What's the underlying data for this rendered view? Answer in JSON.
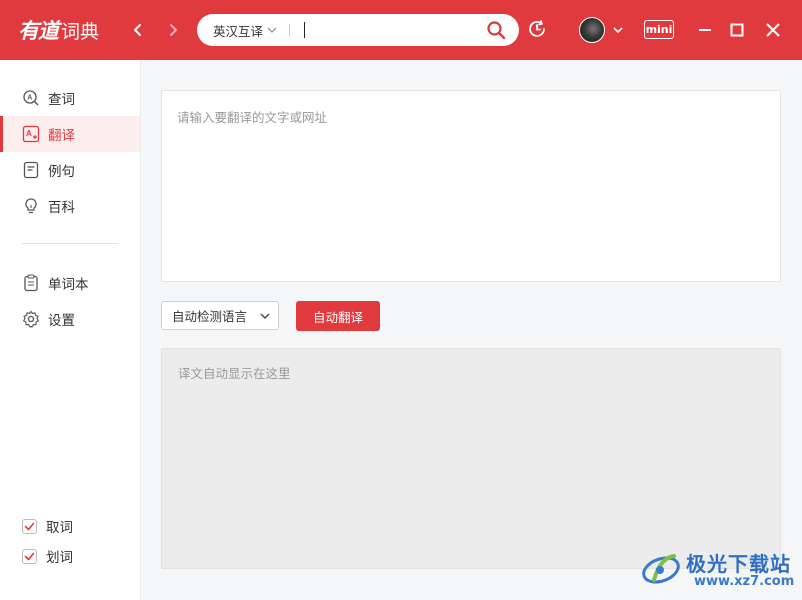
{
  "app": {
    "brand": "有道",
    "product": "词典"
  },
  "titlebar": {
    "search": {
      "lang_mode": "英汉互译",
      "placeholder": "",
      "value": ""
    },
    "mini_label": "mini"
  },
  "sidebar": {
    "items": [
      {
        "label": "查词",
        "icon": "lookup-icon"
      },
      {
        "label": "翻译",
        "icon": "translate-icon",
        "active": true
      },
      {
        "label": "例句",
        "icon": "sentence-icon"
      },
      {
        "label": "百科",
        "icon": "bulb-icon"
      },
      {
        "label": "单词本",
        "icon": "wordbook-icon"
      },
      {
        "label": "设置",
        "icon": "gear-icon"
      }
    ],
    "toggles": [
      {
        "label": "取词",
        "checked": true
      },
      {
        "label": "划词",
        "checked": true
      }
    ]
  },
  "main": {
    "source_placeholder": "请输入要翻译的文字或网址",
    "source_value": "",
    "language_select": "自动检测语言",
    "translate_button": "自动翻译",
    "result_placeholder": "译文自动显示在这里"
  },
  "watermark": {
    "title": "极光下载站",
    "url": "www.xz7.com"
  },
  "colors": {
    "accent": "#e0393e",
    "active_bg": "#fdeeee",
    "watermark_blue": "#2f6fc3"
  }
}
